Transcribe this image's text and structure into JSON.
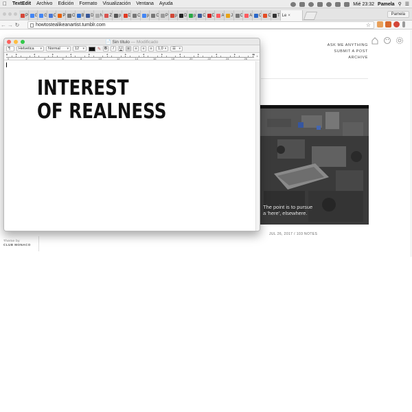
{
  "menubar": {
    "app_name": "TextEdit",
    "menus": [
      "Archivo",
      "Edición",
      "Formato",
      "Visualización",
      "Ventana",
      "Ayuda"
    ],
    "clock": "Mié 23:32",
    "user": "Pamela"
  },
  "browser": {
    "tabs": [
      {
        "label": "P",
        "color": "#d44638"
      },
      {
        "label": "G",
        "color": "#4285f4"
      },
      {
        "label": "G",
        "color": "#4285f4"
      },
      {
        "label": "C",
        "color": "#4a77d4"
      },
      {
        "label": "P",
        "color": "#e66000"
      },
      {
        "label": "O",
        "color": "#777777"
      },
      {
        "label": "B",
        "color": "#2c6ed5"
      },
      {
        "label": "D",
        "color": "#3b5998"
      },
      {
        "label": "Nuev",
        "color": "#aaaaaa"
      },
      {
        "label": "Z",
        "color": "#d9534f"
      },
      {
        "label": "p",
        "color": "#555555"
      },
      {
        "label": "D",
        "color": "#e03b24"
      },
      {
        "label": "C",
        "color": "#777777"
      },
      {
        "label": "p",
        "color": "#4285f4"
      },
      {
        "label": "C",
        "color": "#777777"
      },
      {
        "label": "P",
        "color": "#999999"
      },
      {
        "label": "p",
        "color": "#d14836"
      },
      {
        "label": "D",
        "color": "#222222"
      },
      {
        "label": "p",
        "color": "#2aa845"
      },
      {
        "label": "C",
        "color": "#3b5998"
      },
      {
        "label": "D",
        "color": "#cc2222"
      },
      {
        "label": "A",
        "color": "#ff5a5f"
      },
      {
        "label": "J",
        "color": "#e8a317"
      },
      {
        "label": "C",
        "color": "#777777"
      },
      {
        "label": "A",
        "color": "#ff5a5f"
      },
      {
        "label": "C",
        "color": "#2a66c8"
      },
      {
        "label": "C",
        "color": "#e44d26"
      },
      {
        "label": "T",
        "color": "#333333"
      }
    ],
    "active_tab": "Le",
    "profile": "Pamela",
    "url": "howtostealikeanartist.tumblr.com"
  },
  "textedit": {
    "title": "Sin título",
    "status": "— Modificado",
    "style_select": "¶",
    "font_family": "Helvetica",
    "font_style": "Normal",
    "font_size": "12",
    "bold": "B",
    "italic": "I",
    "underline": "U",
    "line_spacing": "1,0",
    "ruler_numbers": [
      "0",
      "2",
      "4",
      "6",
      "8",
      "10",
      "12",
      "14",
      "16",
      "18",
      "20",
      "22",
      "24",
      "26"
    ],
    "document_text_line1": "INTEREST",
    "document_text_line2": "OF REALNESS"
  },
  "blog": {
    "nav": [
      "ASK ME ANYTHING",
      "SUBMIT A POST",
      "ARCHIVE"
    ],
    "video_subtitle_line1": "The point is to pursue",
    "video_subtitle_line2": "a 'here', elsewhere.",
    "post_meta": "JUL 26, 2017 / 103 NOTES",
    "footer_theme_by": "Theme by",
    "footer_brand": "CLUB MONACO"
  }
}
